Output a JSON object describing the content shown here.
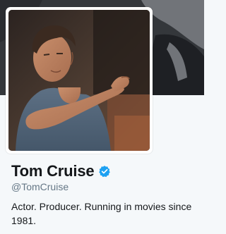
{
  "profile": {
    "name": "Tom Cruise",
    "screen_name": "@TomCruise",
    "bio": "Actor. Producer. Running in movies since 1981.",
    "verified": true
  },
  "icons": {
    "verified": "verified-badge-icon"
  },
  "colors": {
    "background": "#f5f8fa",
    "verified_badge": "#1da1f2",
    "name_text": "#14171a",
    "screen_name_text": "#657786",
    "avatar_border": "#ffffff"
  }
}
